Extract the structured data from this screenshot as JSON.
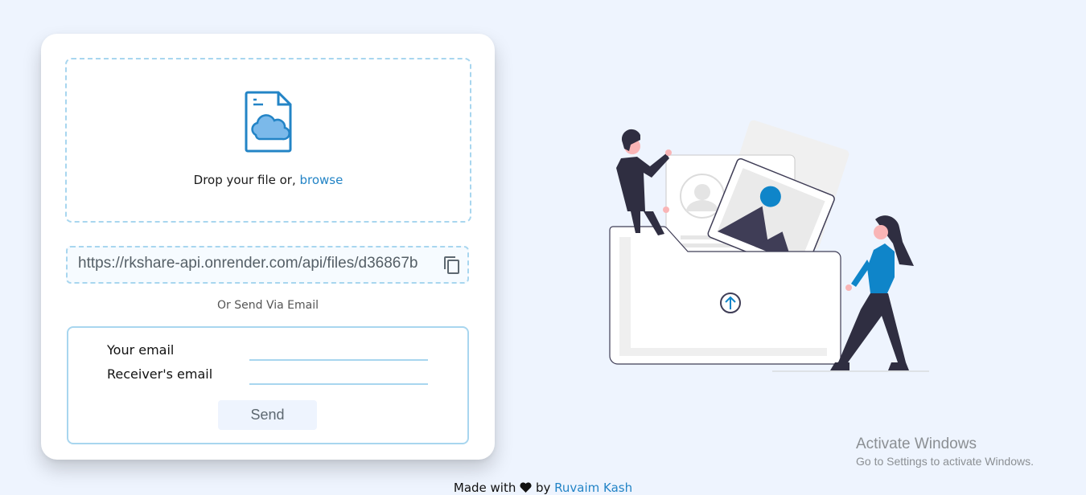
{
  "upload": {
    "drop_prefix": "Drop your file or, ",
    "browse_label": "browse",
    "icon": "cloud-file-icon"
  },
  "share": {
    "url": "https://rkshare-api.onrender.com/api/files/d36867b",
    "copy_icon": "copy-icon"
  },
  "email": {
    "divider_text": "Or Send Via Email",
    "your_email_label": "Your email",
    "your_email_value": "",
    "receiver_email_label": "Receiver's email",
    "receiver_email_value": "",
    "send_label": "Send"
  },
  "footer": {
    "made_with": "Made with",
    "heart_icon": "heart-icon",
    "by": "by",
    "author": "Ruvaim Kash"
  },
  "watermark": {
    "title": "Activate Windows",
    "subtitle": "Go to Settings to activate Windows."
  },
  "colors": {
    "page_bg": "#eef4fe",
    "accent": "#2384c6",
    "border": "#a8d6ef",
    "illustration_blue": "#0f85c9"
  }
}
